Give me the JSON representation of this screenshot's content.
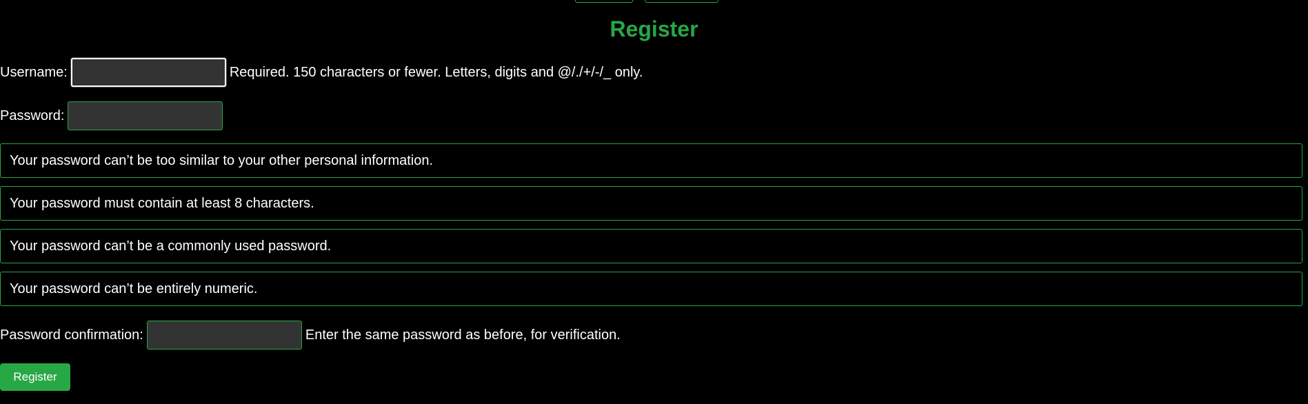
{
  "page": {
    "title": "Register"
  },
  "form": {
    "username": {
      "label": "Username:",
      "value": "",
      "help": "Required. 150 characters or fewer. Letters, digits and @/./+/-/_ only."
    },
    "password": {
      "label": "Password:",
      "value": ""
    },
    "password_rules": [
      "Your password can’t be too similar to your other personal information.",
      "Your password must contain at least 8 characters.",
      "Your password can’t be a commonly used password.",
      "Your password can’t be entirely numeric."
    ],
    "password_confirmation": {
      "label": "Password confirmation:",
      "value": "",
      "help": "Enter the same password as before, for verification."
    },
    "submit_label": "Register"
  },
  "colors": {
    "background": "#000000",
    "accent": "#28a745",
    "input_bg": "#333333",
    "text": "#ffffff"
  }
}
